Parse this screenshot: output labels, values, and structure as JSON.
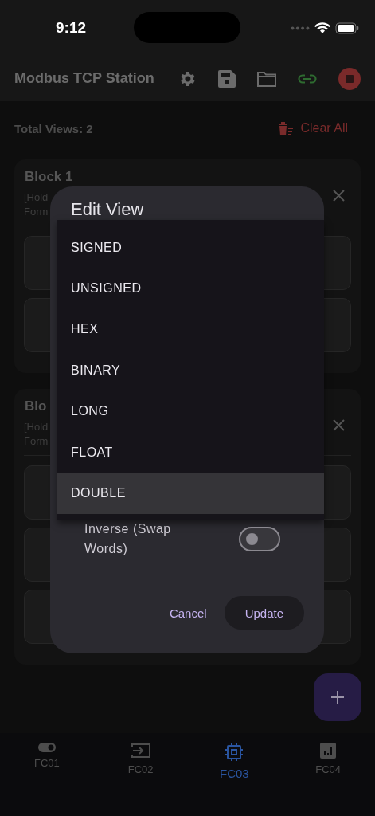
{
  "status_bar": {
    "time": "9:12"
  },
  "app_bar": {
    "title": "Modbus TCP Station"
  },
  "summary": {
    "total": "Total Views: 2",
    "clear_button": "Clear All"
  },
  "blocks": [
    {
      "title": "Block 1",
      "line_1": "[Hold",
      "line_2": "Form"
    },
    {
      "title": "Blo",
      "line_1": "[Hold",
      "line_2": "Form"
    }
  ],
  "dialog": {
    "title": "Edit View",
    "options": [
      {
        "label": "SIGNED",
        "selected": false
      },
      {
        "label": "UNSIGNED",
        "selected": false
      },
      {
        "label": "HEX",
        "selected": false
      },
      {
        "label": "BINARY",
        "selected": false
      },
      {
        "label": "LONG",
        "selected": false
      },
      {
        "label": "FLOAT",
        "selected": false
      },
      {
        "label": "DOUBLE",
        "selected": true
      }
    ],
    "inverse": {
      "label": "Inverse (Swap Words)",
      "on": false
    },
    "cancel": "Cancel",
    "confirm": "Update"
  },
  "nav": [
    {
      "label": "FC01",
      "selected": false
    },
    {
      "label": "FC02",
      "selected": false
    },
    {
      "label": "FC03",
      "selected": true
    },
    {
      "label": "FC04",
      "selected": false
    }
  ]
}
